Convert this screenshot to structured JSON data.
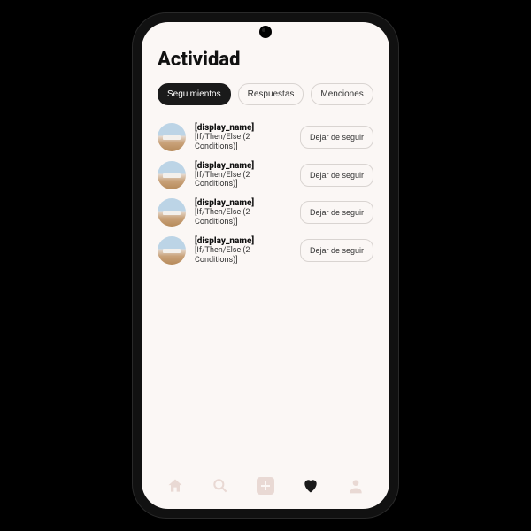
{
  "header": {
    "title": "Actividad"
  },
  "tabs": [
    {
      "label": "Seguimientos",
      "active": true
    },
    {
      "label": "Respuestas",
      "active": false
    },
    {
      "label": "Menciones",
      "active": false
    }
  ],
  "list": {
    "action_label": "Dejar de seguir",
    "items": [
      {
        "name": "[display_name]",
        "sub": "[If/Then/Else (2 Conditions)]"
      },
      {
        "name": "[display_name]",
        "sub": "[If/Then/Else (2 Conditions)]"
      },
      {
        "name": "[display_name]",
        "sub": "[If/Then/Else (2 Conditions)]"
      },
      {
        "name": "[display_name]",
        "sub": "[If/Then/Else (2 Conditions)]"
      }
    ]
  },
  "nav": {
    "items": [
      "home",
      "search",
      "add",
      "heart",
      "profile"
    ],
    "active": "heart"
  }
}
